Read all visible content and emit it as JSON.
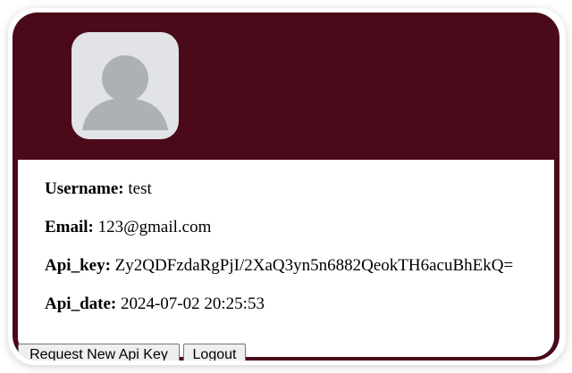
{
  "profile": {
    "avatar_icon": "user-placeholder-icon",
    "username_label": "Username:",
    "username_value": " test",
    "email_label": "Email:",
    "email_value": " 123@gmail.com",
    "api_key_label": "Api_key:",
    "api_key_value": " Zy2QDFzdaRgPjI/2XaQ3yn5n6882QeokTH6acuBhEkQ=",
    "api_date_label": "Api_date:",
    "api_date_value": " 2024-07-02 20:25:53"
  },
  "actions": {
    "request_label": "Request New Api Key",
    "logout_label": "Logout"
  },
  "colors": {
    "header_bg": "#4a0a1a",
    "avatar_bg": "#e1e3e6",
    "avatar_fg": "#adb1b5"
  }
}
